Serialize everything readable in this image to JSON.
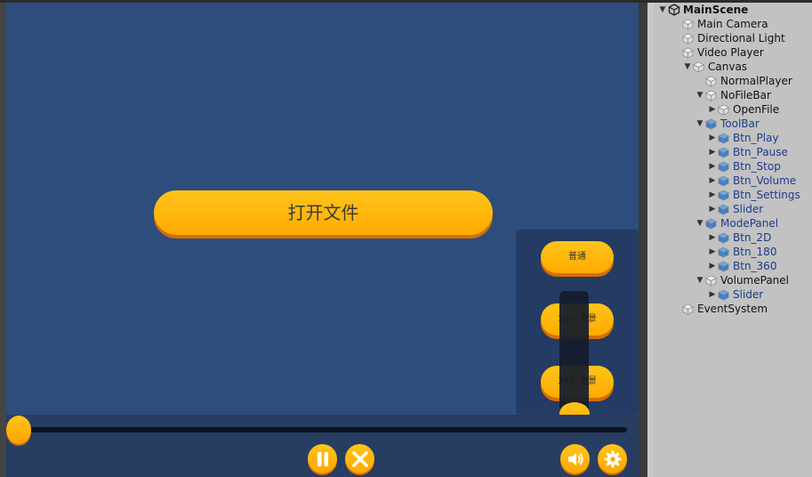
{
  "game": {
    "open_button": "打开文件",
    "mode_buttons": [
      "普通",
      "180°全景",
      "360°全景"
    ],
    "progress": 0.0,
    "volume_level": 0.0,
    "toolbar_icons": [
      "pause-icon",
      "close-icon",
      "volume-icon",
      "settings-icon"
    ]
  },
  "hierarchy": {
    "scene": "MainScene",
    "items": [
      {
        "label": "Main Camera",
        "depth": 1,
        "arrow": "",
        "prefab": false
      },
      {
        "label": "Directional Light",
        "depth": 1,
        "arrow": "",
        "prefab": false
      },
      {
        "label": "Video Player",
        "depth": 1,
        "arrow": "",
        "prefab": false
      },
      {
        "label": "Canvas",
        "depth": 1,
        "arrow": "expanded",
        "prefab": false
      },
      {
        "label": "NormalPlayer",
        "depth": 2,
        "arrow": "",
        "prefab": false
      },
      {
        "label": "NoFileBar",
        "depth": 2,
        "arrow": "expanded",
        "prefab": false
      },
      {
        "label": "OpenFile",
        "depth": 3,
        "arrow": "collapsed",
        "prefab": false
      },
      {
        "label": "ToolBar",
        "depth": 2,
        "arrow": "expanded",
        "prefab": true
      },
      {
        "label": "Btn_Play",
        "depth": 3,
        "arrow": "collapsed",
        "prefab": true
      },
      {
        "label": "Btn_Pause",
        "depth": 3,
        "arrow": "collapsed",
        "prefab": true
      },
      {
        "label": "Btn_Stop",
        "depth": 3,
        "arrow": "collapsed",
        "prefab": true
      },
      {
        "label": "Btn_Volume",
        "depth": 3,
        "arrow": "collapsed",
        "prefab": true
      },
      {
        "label": "Btn_Settings",
        "depth": 3,
        "arrow": "collapsed",
        "prefab": true
      },
      {
        "label": "Slider",
        "depth": 3,
        "arrow": "collapsed",
        "prefab": true
      },
      {
        "label": "ModePanel",
        "depth": 2,
        "arrow": "expanded",
        "prefab": true
      },
      {
        "label": "Btn_2D",
        "depth": 3,
        "arrow": "collapsed",
        "prefab": true
      },
      {
        "label": "Btn_180",
        "depth": 3,
        "arrow": "collapsed",
        "prefab": true
      },
      {
        "label": "Btn_360",
        "depth": 3,
        "arrow": "collapsed",
        "prefab": true
      },
      {
        "label": "VolumePanel",
        "depth": 2,
        "arrow": "expanded",
        "prefab": false
      },
      {
        "label": "Slider",
        "depth": 3,
        "arrow": "collapsed",
        "prefab": true
      },
      {
        "label": "EventSystem",
        "depth": 1,
        "arrow": "",
        "prefab": false
      }
    ]
  },
  "colors": {
    "game_bg": "#2e4d7d",
    "button_yellow": "#ffb800",
    "button_shadow": "#d96d00",
    "hierarchy_bg": "#c2c2c2",
    "prefab_text": "#1d3a8a"
  }
}
